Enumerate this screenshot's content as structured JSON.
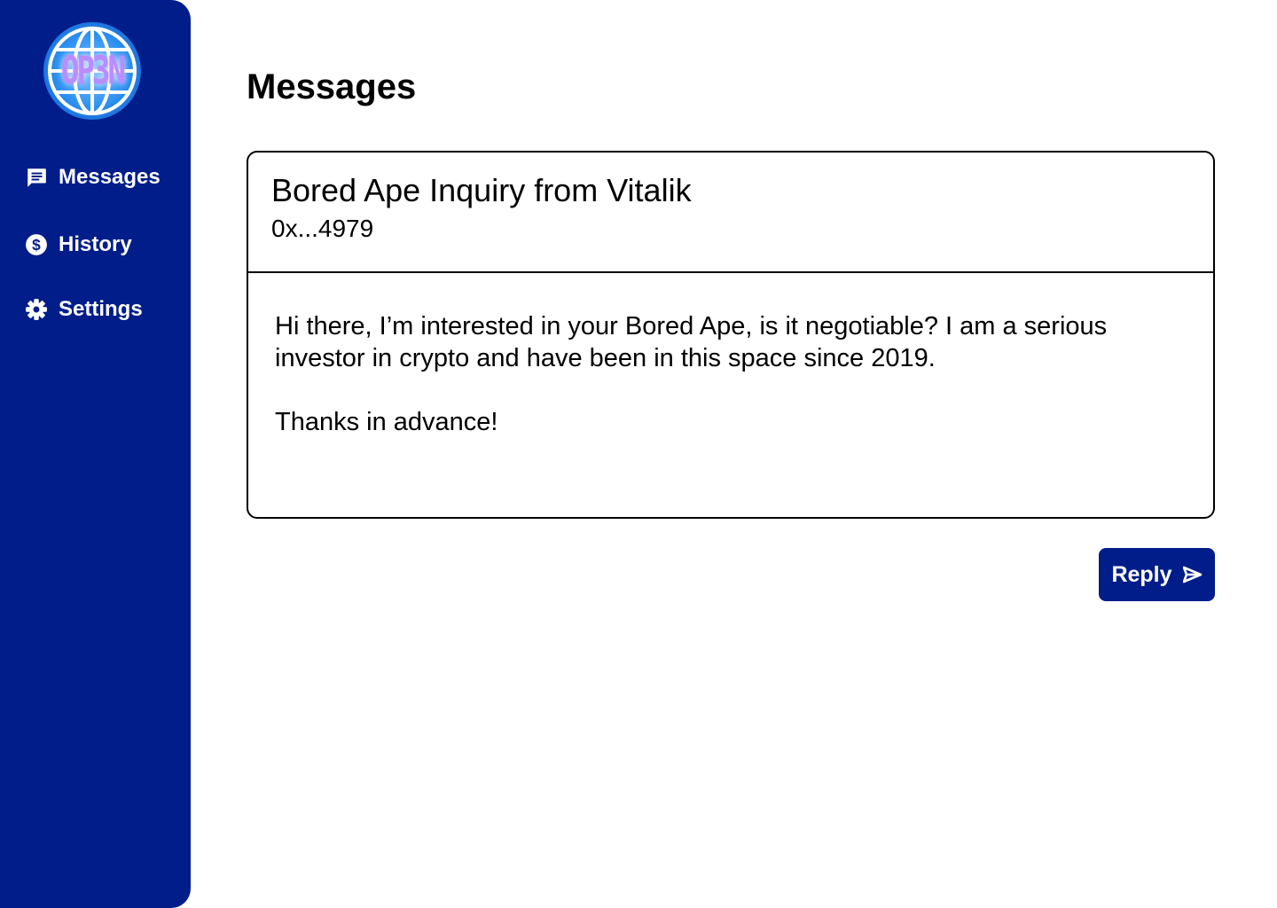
{
  "sidebar": {
    "logo_text": "OP3N",
    "items": [
      {
        "label": "Messages",
        "icon": "message-icon"
      },
      {
        "label": "History",
        "icon": "dollar-icon"
      },
      {
        "label": "Settings",
        "icon": "gear-icon"
      }
    ]
  },
  "main": {
    "title": "Messages",
    "message": {
      "subject": "Bored Ape Inquiry from Vitalik",
      "sender": "0x...4979",
      "body": [
        "Hi there, I’m interested in your Bored Ape, is it negotiable? I am a serious investor in crypto and have been in this space since 2019.",
        "Thanks in advance!"
      ]
    },
    "reply_label": "Reply"
  },
  "colors": {
    "brand": "#001d8a",
    "background": "#ffffff",
    "text": "#000000"
  }
}
